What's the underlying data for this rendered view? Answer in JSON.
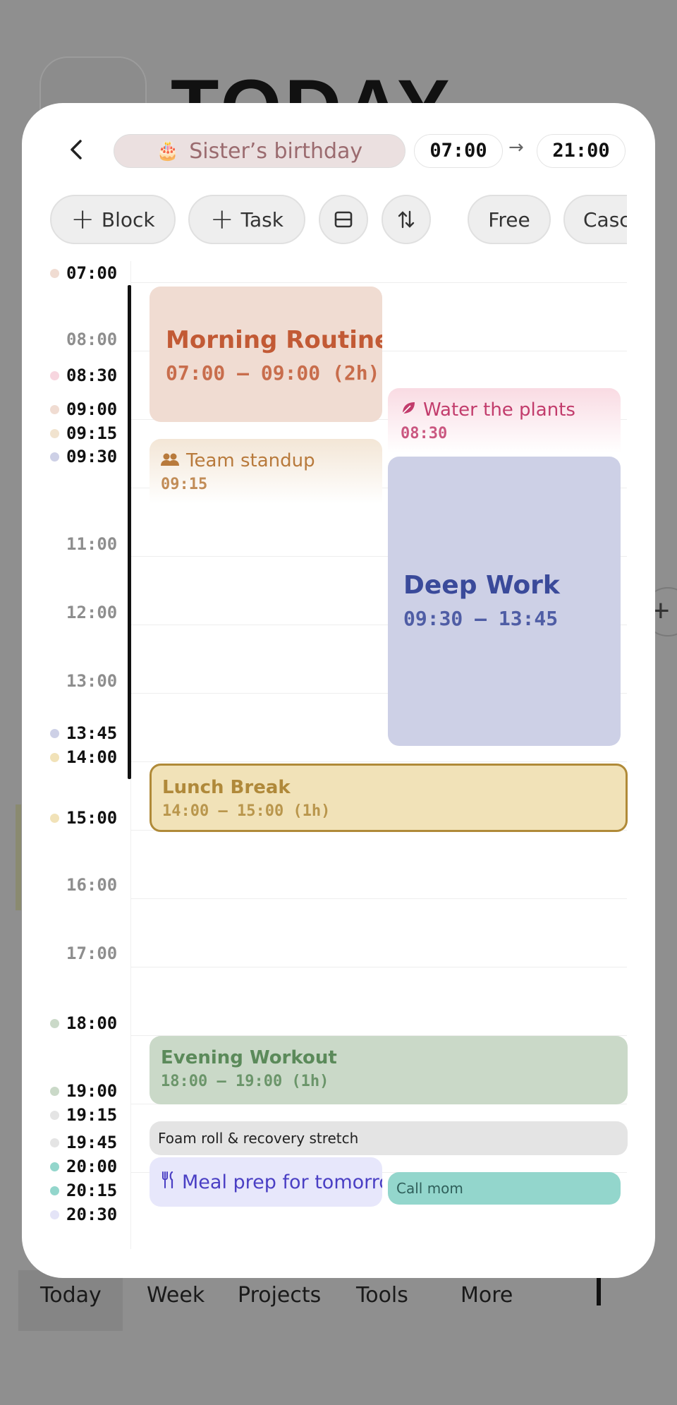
{
  "background": {
    "title": "TODAY",
    "tabs": [
      "Today",
      "Week",
      "Projects",
      "Tools",
      "More"
    ],
    "plus_label": "+"
  },
  "header": {
    "back_icon": "chevron-left-icon",
    "title": "Sister’s birthday",
    "title_icon": "cake-icon",
    "start_time": "07:00",
    "end_time": "21:00",
    "arrow": "→"
  },
  "toolbar": {
    "block_label": "Block",
    "task_label": "Task",
    "layout_icon": "split-view-icon",
    "sort_icon": "sort-arrows-icon",
    "free_label": "Free",
    "cascade_label": "Cascade"
  },
  "timeline": {
    "ticks": [
      {
        "label": "07:00",
        "color": "#f0dcd2",
        "muted": false
      },
      {
        "label": "08:00",
        "color": "",
        "muted": true
      },
      {
        "label": "08:30",
        "color": "#f7d6df",
        "muted": false
      },
      {
        "label": "09:00",
        "color": "#f0dcd2",
        "muted": false
      },
      {
        "label": "09:15",
        "color": "#f1e3cf",
        "muted": false
      },
      {
        "label": "09:30",
        "color": "#cdd0e6",
        "muted": false
      },
      {
        "label": "11:00",
        "color": "",
        "muted": true
      },
      {
        "label": "12:00",
        "color": "",
        "muted": true
      },
      {
        "label": "13:00",
        "color": "",
        "muted": true
      },
      {
        "label": "13:45",
        "color": "#cdd0e6",
        "muted": false
      },
      {
        "label": "14:00",
        "color": "#f1e2b8",
        "muted": false
      },
      {
        "label": "15:00",
        "color": "#f1e2b8",
        "muted": false
      },
      {
        "label": "16:00",
        "color": "",
        "muted": true
      },
      {
        "label": "17:00",
        "color": "",
        "muted": true
      },
      {
        "label": "18:00",
        "color": "#cad9c8",
        "muted": false
      },
      {
        "label": "19:00",
        "color": "#cad9c8",
        "muted": false
      },
      {
        "label": "19:15",
        "color": "#e4e4e4",
        "muted": false
      },
      {
        "label": "19:45",
        "color": "#e4e4e4",
        "muted": false
      },
      {
        "label": "20:00",
        "color": "#93d6cc",
        "muted": false
      },
      {
        "label": "20:15",
        "color": "#93d6cc",
        "muted": false
      },
      {
        "label": "20:30",
        "color": "#e4e4f7",
        "muted": false
      }
    ],
    "events": {
      "morning": {
        "title": "Morning Routine",
        "time": "07:00 – 09:00 (2h)",
        "bg": "#f0dcd2",
        "fg": "#c25a35"
      },
      "water": {
        "title": "Water the plants",
        "time": "08:30",
        "icon": "leaf-icon",
        "bg": "#f9dbe3",
        "fg": "#c23c6c"
      },
      "standup": {
        "title": "Team standup",
        "time": "09:15",
        "icon": "people-icon",
        "bg": "#f3e6d6",
        "fg": "#b87a3c"
      },
      "deepwork": {
        "title": "Deep Work",
        "time": "09:30 – 13:45",
        "bg": "#cdd0e6",
        "fg": "#3a4a9a"
      },
      "lunch": {
        "title": "Lunch Break",
        "time": "14:00 – 15:00 (1h)",
        "bg": "#f1e2b8",
        "fg": "#b0893a",
        "border": "#b08a38"
      },
      "workout": {
        "title": "Evening Workout",
        "time": "18:00 – 19:00 (1h)",
        "bg": "#cad9c8",
        "fg": "#5b8a5a"
      },
      "foamroll": {
        "title": "Foam roll & recovery stretch",
        "bg": "#e4e4e4",
        "fg": "#222"
      },
      "mealprep": {
        "title": "Meal prep for tomorrow",
        "icon": "fork-knife-icon",
        "bg": "#e7e7fb",
        "fg": "#4a3fc4"
      },
      "callmom": {
        "title": "Call mom",
        "bg": "#93d6cc",
        "fg": "#2f5f5a"
      }
    }
  }
}
